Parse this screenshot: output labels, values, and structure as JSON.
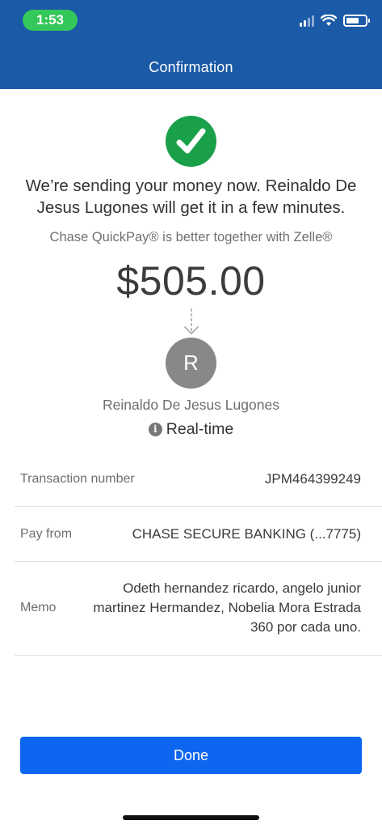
{
  "status_bar": {
    "time": "1:53",
    "icons": [
      "cellular-signal-icon",
      "wifi-icon",
      "battery-icon"
    ]
  },
  "header": {
    "title": "Confirmation"
  },
  "confirmation": {
    "icon": "checkmark-circle-icon",
    "message": "We’re sending your money now. Reinaldo De Jesus Lugones will get it in a few minutes.",
    "subtitle": "Chase QuickPay® is better together with Zelle®",
    "amount": "$505.00"
  },
  "recipient": {
    "initial": "R",
    "name": "Reinaldo De Jesus Lugones",
    "delivery_icon": "i",
    "delivery_speed": "Real-time"
  },
  "details": [
    {
      "label": "Transaction number",
      "value": "JPM464399249"
    },
    {
      "label": "Pay from",
      "value": "CHASE SECURE BANKING (...7775)"
    },
    {
      "label": "Memo",
      "value": "Odeth hernandez ricardo, angelo junior martinez Hermandez, Nobelia Mora Estrada 360 por cada uno."
    }
  ],
  "done_button": {
    "label": "Done"
  },
  "colors": {
    "header_blue": "#1a5aa6",
    "success_green": "#1aa049",
    "button_blue": "#0d66f0",
    "time_pill_green": "#34c759"
  }
}
